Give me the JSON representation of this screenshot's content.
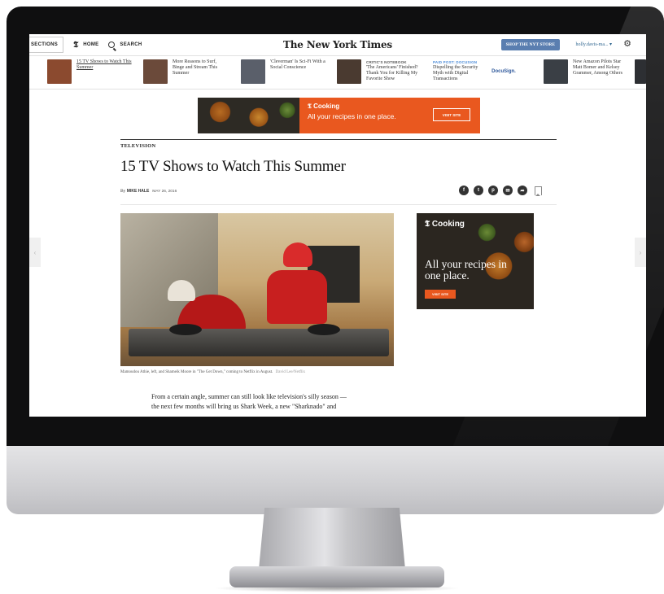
{
  "topbar": {
    "sections_label": "SECTIONS",
    "nyt_icon_glyph": "𝕿",
    "home_label": "HOME",
    "search_label": "SEARCH",
    "masthead": "The New York Times",
    "shop_label": "SHOP THE NYT STORE",
    "user_label": "holly.davis-ma...",
    "gear_glyph": "⚙"
  },
  "ribbon": {
    "items": [
      {
        "title": "15 TV Shows to Watch This Summer",
        "color": "#8b4a2f"
      },
      {
        "title": "More Reasons to Surf, Binge and Stream This Summer",
        "color": "#6b4a3a"
      },
      {
        "title": "'Cleverman' Is Sci-Fi With a Social Conscience",
        "color": "#5a5f6a"
      },
      {
        "kicker": "CRITIC'S NOTEBOOK",
        "title": "'The Americans' Finished? Thank You for Killing My Favorite Show",
        "color": "#4a3a30"
      },
      {
        "kicker": "PAID POST: DOCUSIGN",
        "title": "Dispelling the Security Myth with Digital Transactions",
        "logo": "DocuSign."
      },
      {
        "title": "New Amazon Pilots Star Matt Bomer and Kelsey Grammer, Among Others",
        "color": "#3a3f45"
      }
    ]
  },
  "banner_ad": {
    "logo": "𝕿 Cooking",
    "tagline": "All your recipes in one place.",
    "visit": "VISIT SITE"
  },
  "article": {
    "section": "TELEVISION",
    "headline": "15 TV Shows to Watch This Summer",
    "by": "By ",
    "author": "MIKE HALE",
    "date": "MAY 26, 2016",
    "caption": "Mamoudou Athie, left, and Shameik Moore in \"The Get Down,\" coming to Netflix in August.",
    "credit": "David Lee/Netflix",
    "body_line1": "From a certain angle, summer can still look like television's silly season —",
    "body_line2": "the next few months will bring us Shark Week, a new \"Sharknado\" and"
  },
  "share": [
    "f",
    "t",
    "p",
    "✉",
    "➦"
  ],
  "side_ad": {
    "logo": "𝕿 Cooking",
    "tagline": "All your recipes in one place.",
    "visit": "VISIT SITE"
  },
  "arrows": {
    "left": "‹",
    "right": "›"
  }
}
